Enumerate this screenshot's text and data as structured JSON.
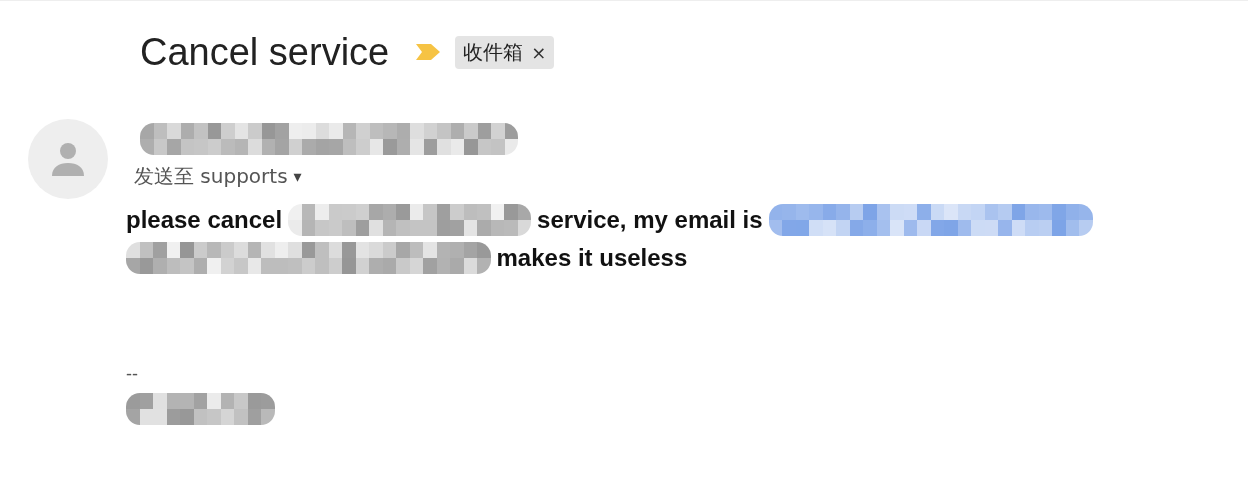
{
  "subject": "Cancel service",
  "label": {
    "text": "收件箱",
    "remove": "×"
  },
  "sender": {
    "name": {
      "kind": "redacted-name"
    },
    "to_prefix": "发送至",
    "to": "supports",
    "caret": "▾"
  },
  "body": [
    [
      {
        "kind": "text",
        "text": "please cancel"
      },
      {
        "kind": "redacted"
      },
      {
        "kind": "text",
        "text": "service, my email is"
      },
      {
        "kind": "redacted-link"
      }
    ],
    [
      {
        "kind": "redacted-long"
      },
      {
        "kind": "text",
        "text": "makes it useless"
      }
    ]
  ],
  "signature": {
    "dashes": "--",
    "name": {
      "kind": "redacted-signature"
    }
  }
}
